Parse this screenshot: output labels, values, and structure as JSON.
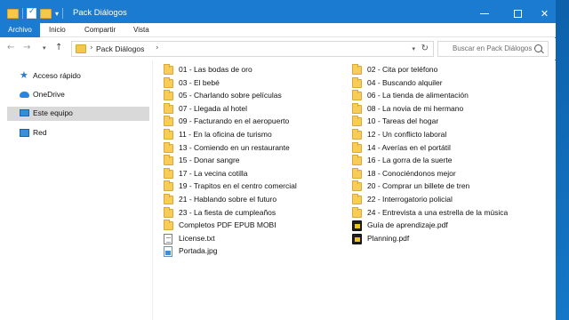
{
  "window": {
    "title": "Pack Diálogos",
    "controls": {
      "minimize": "─",
      "maximize": "☐",
      "close": "✕"
    }
  },
  "ribbon": {
    "tabs": [
      "Archivo",
      "Inicio",
      "Compartir",
      "Vista"
    ]
  },
  "address_bar": {
    "path": [
      "Pack Diálogos"
    ],
    "separator": "›"
  },
  "search": {
    "placeholder": "Buscar en Pack Diálogos"
  },
  "nav_pane": {
    "items": [
      {
        "label": "Acceso rápido",
        "icon": "star-icon"
      },
      {
        "label": "OneDrive",
        "icon": "cloud-icon"
      },
      {
        "label": "Este equipo",
        "icon": "computer-icon",
        "selected": true
      },
      {
        "label": "Red",
        "icon": "network-icon"
      }
    ]
  },
  "files": {
    "column1": [
      {
        "name": "01 - Las bodas de oro",
        "type": "folder"
      },
      {
        "name": "03 - El bebé",
        "type": "folder"
      },
      {
        "name": "05 - Charlando sobre películas",
        "type": "folder"
      },
      {
        "name": "07 - Llegada al hotel",
        "type": "folder"
      },
      {
        "name": "09 - Facturando en el aeropuerto",
        "type": "folder"
      },
      {
        "name": "11 - En la oficina de turismo",
        "type": "folder"
      },
      {
        "name": "13 - Comiendo en un restaurante",
        "type": "folder"
      },
      {
        "name": "15 - Donar sangre",
        "type": "folder"
      },
      {
        "name": "17 - La vecina cotilla",
        "type": "folder"
      },
      {
        "name": "19 - Trapitos en el centro comercial",
        "type": "folder"
      },
      {
        "name": "21 - Hablando sobre el futuro",
        "type": "folder"
      },
      {
        "name": "23 - La fiesta de cumpleaños",
        "type": "folder"
      },
      {
        "name": "Completos PDF EPUB MOBI",
        "type": "folder"
      },
      {
        "name": "License.txt",
        "type": "txt"
      },
      {
        "name": "Portada.jpg",
        "type": "jpg"
      }
    ],
    "column2": [
      {
        "name": "02 - Cita por teléfono",
        "type": "folder"
      },
      {
        "name": "04 - Buscando alquiler",
        "type": "folder"
      },
      {
        "name": "06 - La tienda de alimentación",
        "type": "folder"
      },
      {
        "name": "08 - La novia de mi hermano",
        "type": "folder"
      },
      {
        "name": "10 - Tareas del hogar",
        "type": "folder"
      },
      {
        "name": "12 - Un conflicto laboral",
        "type": "folder"
      },
      {
        "name": "14 - Averías en el portátil",
        "type": "folder"
      },
      {
        "name": "16 - La gorra de la suerte",
        "type": "folder"
      },
      {
        "name": "18 - Conociéndonos mejor",
        "type": "folder"
      },
      {
        "name": "20 - Comprar un billete de tren",
        "type": "folder"
      },
      {
        "name": "22 - Interrogatorio policial",
        "type": "folder"
      },
      {
        "name": "24 - Entrevista a una estrella de la música",
        "type": "folder"
      },
      {
        "name": "Guía de aprendizaje.pdf",
        "type": "pdf"
      },
      {
        "name": "Planning.pdf",
        "type": "pdf"
      }
    ]
  }
}
